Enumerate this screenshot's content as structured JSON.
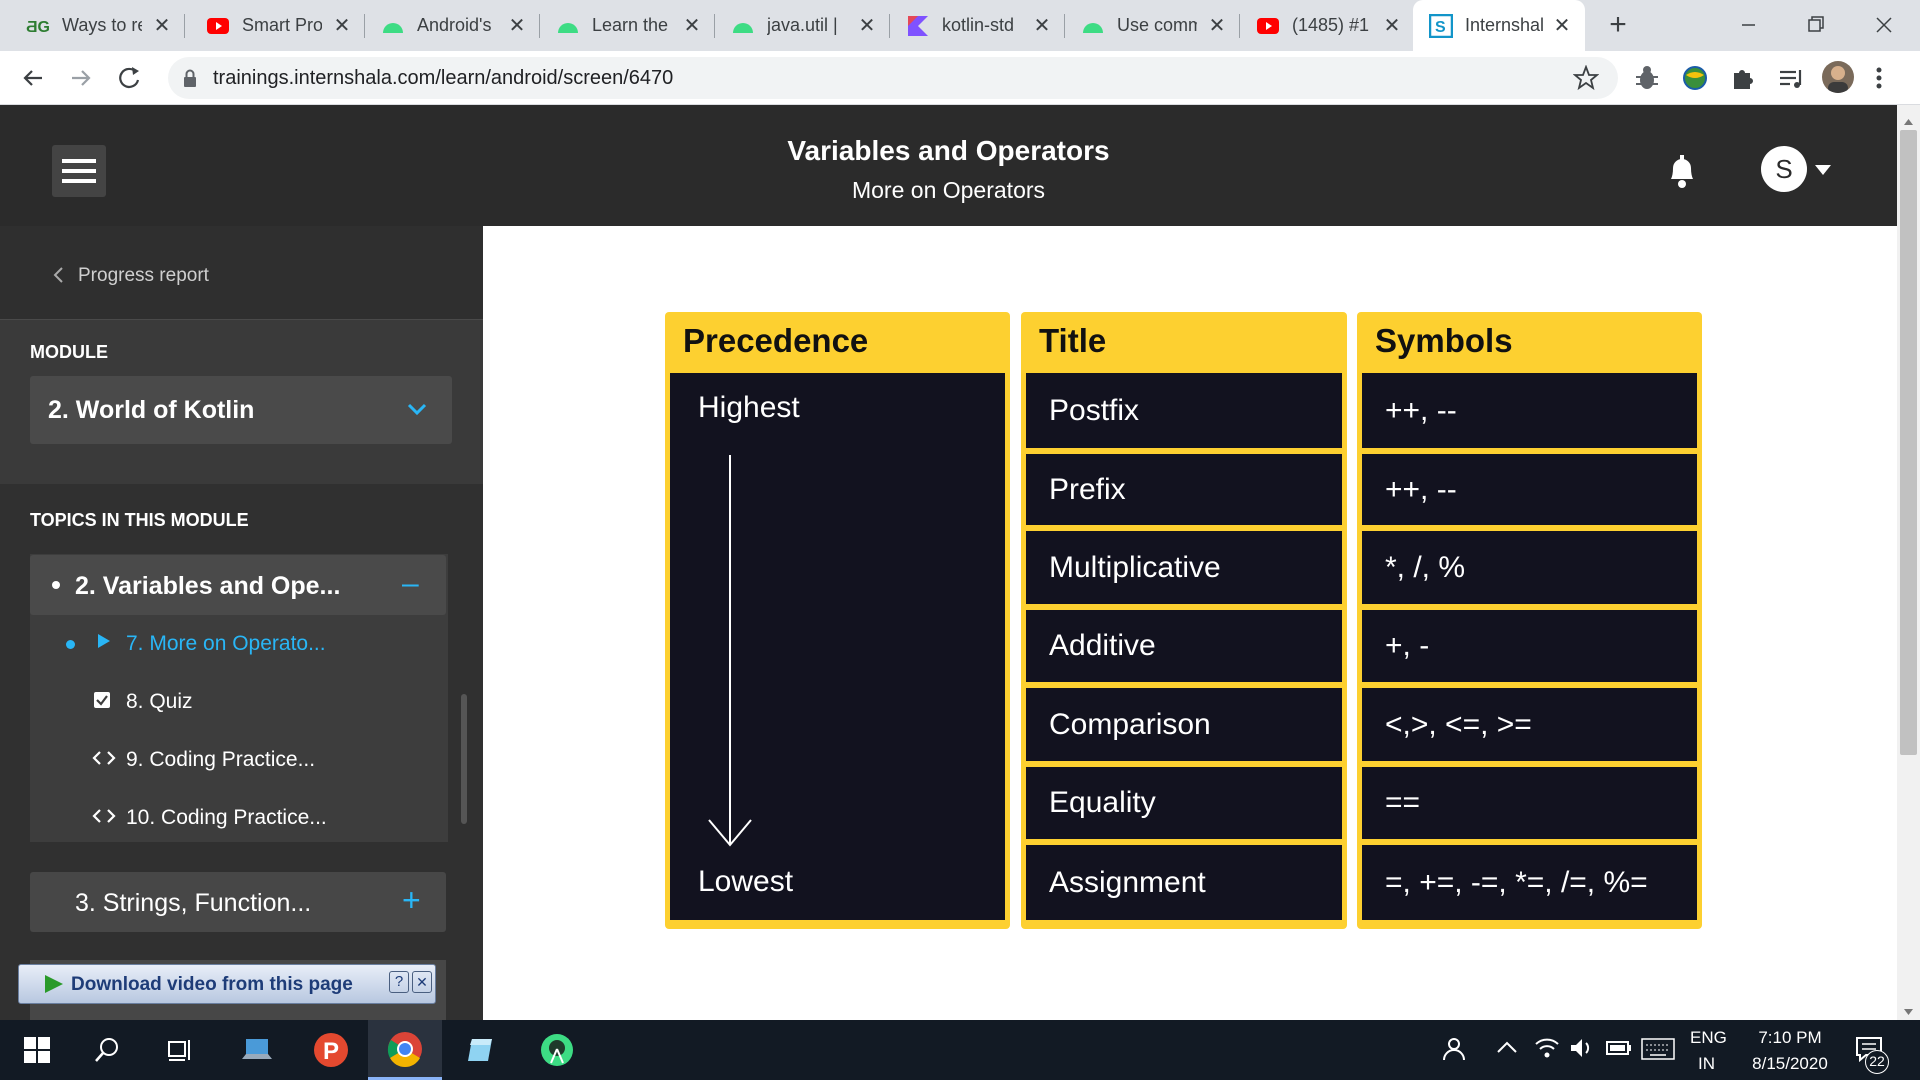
{
  "browser": {
    "tabs": [
      {
        "label": "Ways to re",
        "icon": "dg-icon",
        "active": false
      },
      {
        "label": "Smart Pro",
        "icon": "youtube-icon",
        "active": false
      },
      {
        "label": "Android's",
        "icon": "android-icon",
        "active": false
      },
      {
        "label": "Learn the",
        "icon": "android-icon",
        "active": false
      },
      {
        "label": "java.util |",
        "icon": "android-icon",
        "active": false
      },
      {
        "label": "kotlin-std",
        "icon": "kotlin-icon",
        "active": false
      },
      {
        "label": "Use comm",
        "icon": "android-icon",
        "active": false
      },
      {
        "label": "(1485) #1",
        "icon": "youtube-icon",
        "active": false
      },
      {
        "label": "Internshal",
        "icon": "internshala-icon",
        "active": true
      }
    ],
    "new_tab_glyph": "+",
    "url": "trainings.internshala.com/learn/android/screen/6470"
  },
  "header": {
    "title": "Variables and Operators",
    "subtitle": "More on Operators",
    "avatar_letter": "S"
  },
  "sidebar": {
    "progress_report": "Progress report",
    "module_label": "MODULE",
    "module_value": "2. World of Kotlin",
    "topics_label": "TOPICS IN THIS MODULE",
    "active_topic": "2. Variables and Ope...",
    "active_topic_toggle": "–",
    "subitems": [
      {
        "label": "7. More on Operato...",
        "icon": "play-icon",
        "current": true
      },
      {
        "label": "8. Quiz",
        "icon": "checkbox-icon",
        "current": false
      },
      {
        "label": "9. Coding Practice...",
        "icon": "code-icon",
        "current": false
      },
      {
        "label": "10. Coding Practice...",
        "icon": "code-icon",
        "current": false
      }
    ],
    "next_topic": "3. Strings, Function...",
    "next_topic_toggle": "+",
    "download_bar": "Download video from this page",
    "download_help": "?",
    "download_close": "✕"
  },
  "table": {
    "precedence_header": "Precedence",
    "title_header": "Title",
    "symbols_header": "Symbols",
    "highest": "Highest",
    "lowest": "Lowest",
    "rows": [
      {
        "title": "Postfix",
        "symbols": "++, --"
      },
      {
        "title": "Prefix",
        "symbols": "++, --"
      },
      {
        "title": "Multiplicative",
        "symbols": "*, /, %"
      },
      {
        "title": "Additive",
        "symbols": "+, -"
      },
      {
        "title": "Comparison",
        "symbols": "<,>, <=, >="
      },
      {
        "title": "Equality",
        "symbols": "=="
      },
      {
        "title": "Assignment",
        "symbols": "=, +=, -=, *=, /=, %="
      }
    ]
  },
  "taskbar": {
    "lang_top": "ENG",
    "lang_bottom": "IN",
    "time": "7:10 PM",
    "date": "8/15/2020",
    "notif_count": "22"
  },
  "colors": {
    "accent_yellow": "#fdd030",
    "cell_bg": "#12121f",
    "link_blue": "#29b6f6",
    "header_bg": "#2b2b2b",
    "sidebar_bg": "#3a3a3a"
  }
}
